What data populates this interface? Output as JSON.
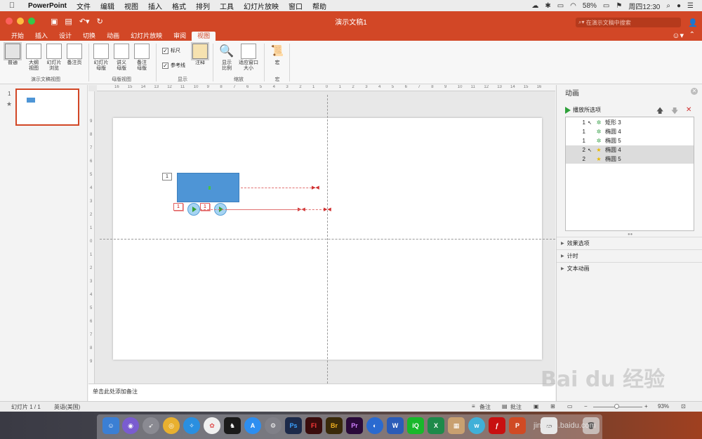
{
  "menubar": {
    "apple": "",
    "items": [
      "PowerPoint",
      "文件",
      "编辑",
      "视图",
      "插入",
      "格式",
      "排列",
      "工具",
      "幻灯片放映",
      "窗口",
      "帮助"
    ],
    "battery": "58%",
    "clock": "周四12:30"
  },
  "titlebar": {
    "title": "演示文稿1",
    "search_placeholder": "在演示文稿中搜索"
  },
  "tabs": [
    "开始",
    "插入",
    "设计",
    "切换",
    "动画",
    "幻灯片放映",
    "审阅",
    "视图"
  ],
  "active_tab": "视图",
  "ribbon": {
    "presentation_views": {
      "label": "演示文稿视图",
      "buttons": [
        "普通",
        "大纲\n视图",
        "幻灯片\n浏览",
        "备注页"
      ]
    },
    "master_views": {
      "label": "母版视图",
      "buttons": [
        "幻灯片\n母版",
        "讲义\n母版",
        "备注\n母版"
      ]
    },
    "show": {
      "label": "显示",
      "ruler": "标尺",
      "guides": "参考线",
      "notes": "注释"
    },
    "zoom": {
      "label": "缩放",
      "zoom_btn": "显示\n比例",
      "fit_btn": "适应窗口\n大小"
    },
    "macro": {
      "label": "宏",
      "btn": "宏"
    }
  },
  "thumbnails": {
    "slide_number": "1",
    "star": "★"
  },
  "slide": {
    "rect_tag": "1",
    "circle1_tag": "1",
    "circle2_tag": "1"
  },
  "notes_placeholder": "单击此处添加备注",
  "animation_pane": {
    "title": "动画",
    "play_label": "播放所选项",
    "items": [
      {
        "order": "1",
        "cursor": "↖",
        "effect": "✲",
        "name": "矩形 3",
        "selected": false
      },
      {
        "order": "1",
        "cursor": "",
        "effect": "✲",
        "name": "椭圆 4",
        "selected": false
      },
      {
        "order": "1",
        "cursor": "",
        "effect": "✲",
        "name": "椭圆 5",
        "selected": false
      },
      {
        "order": "2",
        "cursor": "↖",
        "effect": "★",
        "name": "椭圆 4",
        "selected": true
      },
      {
        "order": "2",
        "cursor": "",
        "effect": "★",
        "name": "椭圆 5",
        "selected": true
      }
    ],
    "sections": [
      "效果选项",
      "计时",
      "文本动画"
    ]
  },
  "statusbar": {
    "slide_info": "幻灯片 1 / 1",
    "language": "英语(美国)",
    "notes_btn": "备注",
    "comments_btn": "批注",
    "zoom_pct": "93%"
  },
  "watermark": {
    "logo_text": "Bai du 经验",
    "url": "jingyan.baidu.com"
  },
  "colors": {
    "accent": "#d24726",
    "shape_fill": "#4e95d6",
    "play_green": "#2ea03a"
  }
}
